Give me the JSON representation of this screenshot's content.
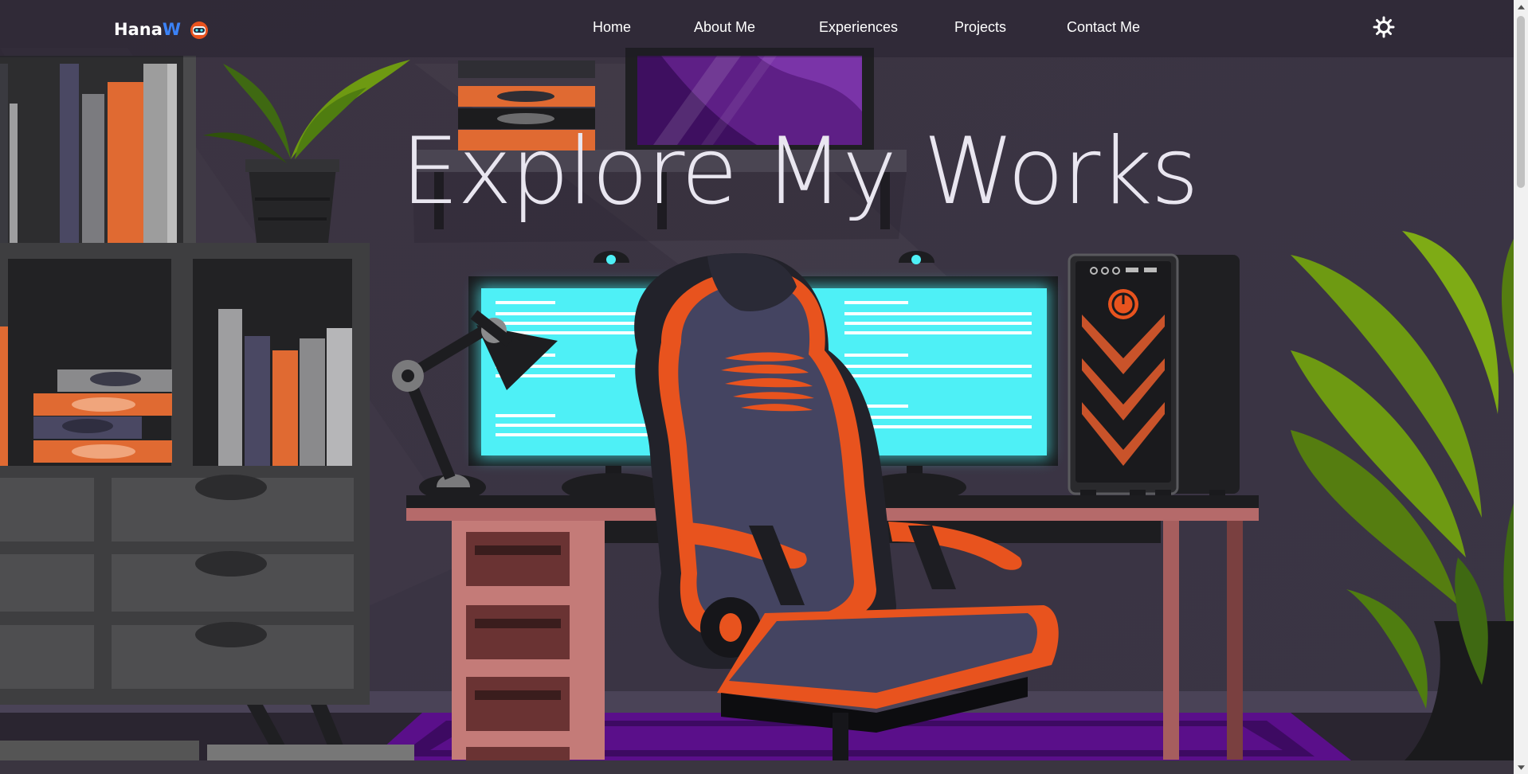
{
  "brand": {
    "name_main": "Hana",
    "name_accent": "W",
    "icon": "robot-avatar-icon"
  },
  "nav": {
    "items": [
      {
        "label": "Home"
      },
      {
        "label": "About Me"
      },
      {
        "label": "Experiences"
      },
      {
        "label": "Projects"
      },
      {
        "label": "Contact Me"
      }
    ],
    "theme_toggle_icon": "sun-icon"
  },
  "hero": {
    "title": "Explore My Works"
  },
  "colors": {
    "accent_blue": "#3b82f6",
    "accent_orange": "#e8531e",
    "screen_cyan": "#4ef0f6",
    "room_purple": "#3b3445",
    "plant_green": "#6e9a12"
  }
}
